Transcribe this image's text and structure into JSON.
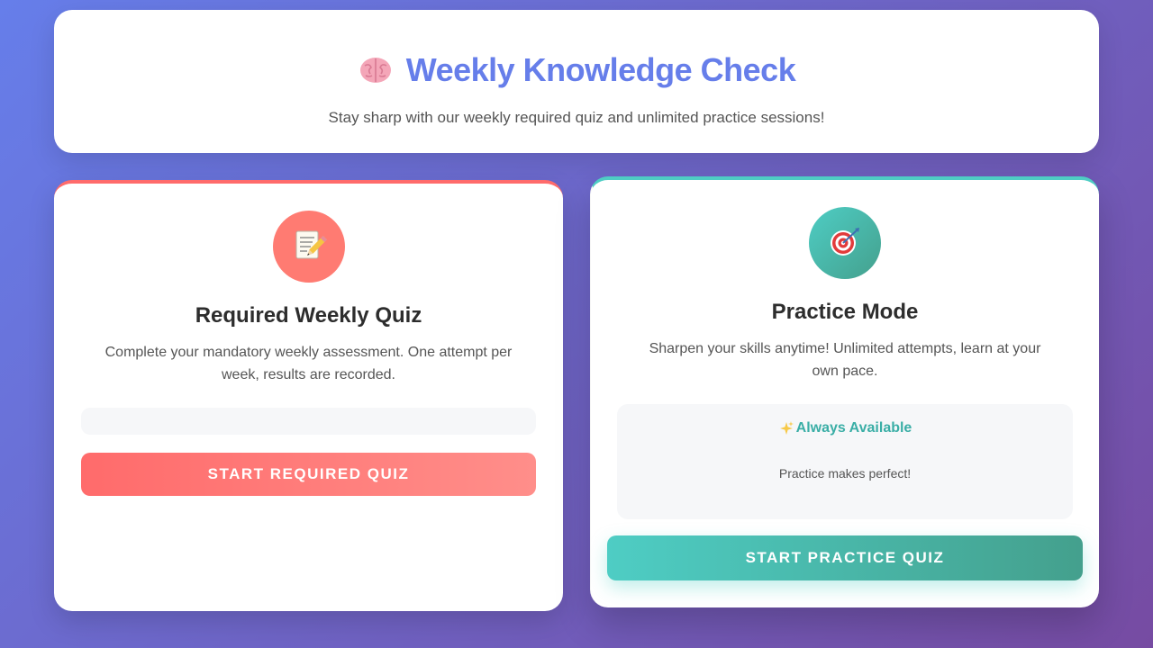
{
  "header": {
    "icon": "brain-icon",
    "title": "Weekly Knowledge Check",
    "subtitle": "Stay sharp with our weekly required quiz and unlimited practice sessions!"
  },
  "required_card": {
    "icon": "memo-pencil-icon",
    "accent_color": "#ff6b6b",
    "title": "Required Weekly Quiz",
    "description": "Complete your mandatory weekly assessment. One attempt per week, results are recorded.",
    "button_label": "Start Required Quiz"
  },
  "practice_card": {
    "icon": "target-icon",
    "accent_color": "#4ecdc4",
    "title": "Practice Mode",
    "description": "Sharpen your skills anytime! Unlimited attempts, learn at your own pace.",
    "availability": {
      "icon": "sparkles-icon",
      "title": "Always Available",
      "subtitle": "Practice makes perfect!"
    },
    "button_label": "Start Practice Quiz"
  },
  "colors": {
    "background_start": "#667eea",
    "background_end": "#764ba2",
    "brand": "#667eea"
  }
}
